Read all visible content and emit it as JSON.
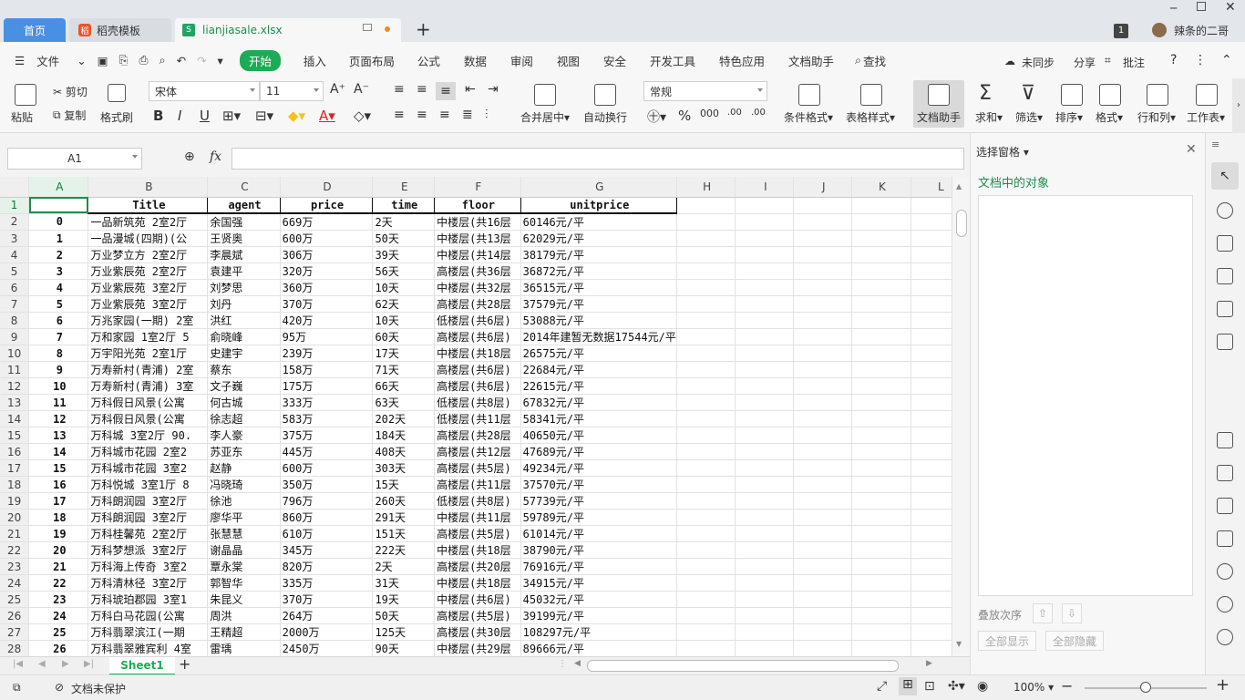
{
  "tabs": {
    "home": "首页",
    "docer": "稻壳模板",
    "file": "lianjiasale.xlsx",
    "add": "+"
  },
  "window": {
    "badge": "1",
    "user": "辣条的二哥"
  },
  "menu": {
    "file": "文件",
    "start": "开始",
    "insert": "插入",
    "layout": "页面布局",
    "formula": "公式",
    "data": "数据",
    "review": "审阅",
    "view": "视图",
    "security": "安全",
    "dev": "开发工具",
    "special": "特色应用",
    "helper": "文档助手",
    "search": "查找",
    "sync": "未同步",
    "share": "分享",
    "annotate": "批注"
  },
  "ribbon": {
    "paste": "粘贴",
    "cut": "剪切",
    "copy": "复制",
    "format_painter": "格式刷",
    "font": "宋体",
    "size": "11",
    "merge": "合并居中",
    "wrap": "自动换行",
    "numfmt": "常规",
    "cond": "条件格式",
    "tablestyle": "表格样式",
    "dochelper": "文档助手",
    "sum": "求和",
    "filter": "筛选",
    "sort": "排序",
    "formatbtn": "格式",
    "rowcol": "行和列",
    "worksheet": "工作表"
  },
  "formula": {
    "cell": "A1",
    "fx": "fx"
  },
  "columns": [
    "A",
    "B",
    "C",
    "D",
    "E",
    "F",
    "G",
    "H",
    "I",
    "J",
    "K",
    "L"
  ],
  "headers": [
    "",
    "Title",
    "agent",
    "price",
    "time",
    "floor",
    "unitprice"
  ],
  "rows": [
    [
      "0",
      "一品新筑苑 2室2厅",
      "余国强",
      "669万",
      "2天",
      "中楼层(共16层",
      "60146元/平"
    ],
    [
      "1",
      "一品漫城(四期)(公",
      "王贤奥",
      "600万",
      "50天",
      "中楼层(共13层",
      "62029元/平"
    ],
    [
      "2",
      "万业梦立方 2室2厅",
      "李晨斌",
      "306万",
      "39天",
      "中楼层(共14层",
      "38179元/平"
    ],
    [
      "3",
      "万业紫辰苑 2室2厅",
      "袁建平",
      "320万",
      "56天",
      "高楼层(共36层",
      "36872元/平"
    ],
    [
      "4",
      "万业紫辰苑 3室2厅",
      "刘梦思",
      "360万",
      "10天",
      "中楼层(共32层",
      "36515元/平"
    ],
    [
      "5",
      "万业紫辰苑 3室2厅",
      "刘丹",
      "370万",
      "62天",
      "高楼层(共28层",
      "37579元/平"
    ],
    [
      "6",
      "万兆家园(一期) 2室",
      "洪红",
      "420万",
      "10天",
      "低楼层(共6层)",
      "53088元/平"
    ],
    [
      "7",
      "万和家园 1室2厅 5",
      "俞晓峰",
      "95万",
      "60天",
      "高楼层(共6层)",
      "2014年建暂无数据17544元/平"
    ],
    [
      "8",
      "万宇阳光苑 2室1厅",
      "史建宇",
      "239万",
      "17天",
      "中楼层(共18层",
      "26575元/平"
    ],
    [
      "9",
      "万寿新村(青浦) 2室",
      "蔡东",
      "158万",
      "71天",
      "高楼层(共6层)",
      "22684元/平"
    ],
    [
      "10",
      "万寿新村(青浦) 3室",
      "文子巍",
      "175万",
      "66天",
      "高楼层(共6层)",
      "22615元/平"
    ],
    [
      "11",
      "万科假日风景(公寓",
      "何古城",
      "333万",
      "63天",
      "低楼层(共8层)",
      "67832元/平"
    ],
    [
      "12",
      "万科假日风景(公寓",
      "徐志超",
      "583万",
      "202天",
      "低楼层(共11层",
      "58341元/平"
    ],
    [
      "13",
      "万科城 3室2厅 90.",
      "李人豪",
      "375万",
      "184天",
      "高楼层(共28层",
      "40650元/平"
    ],
    [
      "14",
      "万科城市花园 2室2",
      "苏亚东",
      "445万",
      "408天",
      "高楼层(共12层",
      "47689元/平"
    ],
    [
      "15",
      "万科城市花园 3室2",
      "赵静",
      "600万",
      "303天",
      "高楼层(共5层)",
      "49234元/平"
    ],
    [
      "16",
      "万科悦城 3室1厅 8",
      "冯晓琦",
      "350万",
      "15天",
      "高楼层(共11层",
      "37570元/平"
    ],
    [
      "17",
      "万科朗润园 3室2厅",
      "徐池",
      "796万",
      "260天",
      "低楼层(共8层)",
      "57739元/平"
    ],
    [
      "18",
      "万科朗润园 3室2厅",
      "廖华平",
      "860万",
      "291天",
      "中楼层(共11层",
      "59789元/平"
    ],
    [
      "19",
      "万科桂馨苑 2室2厅",
      "张慧慧",
      "610万",
      "151天",
      "高楼层(共5层)",
      "61014元/平"
    ],
    [
      "20",
      "万科梦想派 3室2厅",
      "谢晶晶",
      "345万",
      "222天",
      "中楼层(共18层",
      "38790元/平"
    ],
    [
      "21",
      "万科海上传奇 3室2",
      "覃永棠",
      "820万",
      "2天",
      "高楼层(共20层",
      "76916元/平"
    ],
    [
      "22",
      "万科清林径 3室2厅",
      "郭智华",
      "335万",
      "31天",
      "中楼层(共18层",
      "34915元/平"
    ],
    [
      "23",
      "万科琥珀郡园 3室1",
      "朱昆义",
      "370万",
      "19天",
      "中楼层(共6层)",
      "45032元/平"
    ],
    [
      "24",
      "万科白马花园(公寓",
      "周洪",
      "264万",
      "50天",
      "高楼层(共5层)",
      "39199元/平"
    ],
    [
      "25",
      "万科翡翠滨江(一期",
      "王精超",
      "2000万",
      "125天",
      "高楼层(共30层",
      "108297元/平"
    ],
    [
      "26",
      "万科翡翠雅宾利 4室",
      "雷瑀",
      "2450万",
      "90天",
      "中楼层(共29层",
      "89666元/平"
    ]
  ],
  "sheet_tab": "Sheet1",
  "status": {
    "protect": "文档未保护",
    "zoom": "100%"
  },
  "pane": {
    "title": "选择窗格",
    "objects": "文档中的对象",
    "order": "叠放次序",
    "show_all": "全部显示",
    "hide_all": "全部隐藏"
  }
}
